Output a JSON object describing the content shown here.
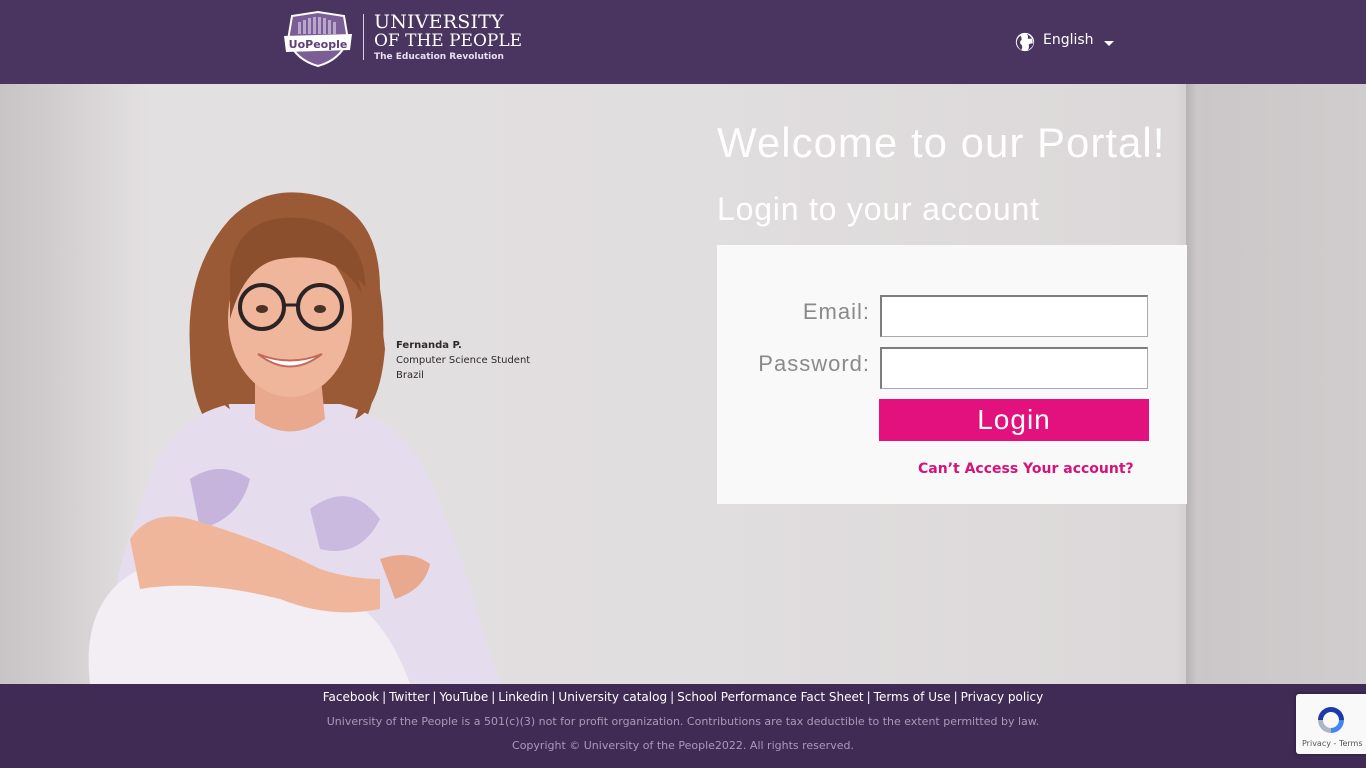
{
  "header": {
    "logo": {
      "badge_text": "UoPeople",
      "line1": "UNIVERSITY",
      "line2": "OF THE PEOPLE",
      "tagline": "The Education Revolution"
    },
    "language": {
      "selected": "English",
      "icon": "globe-icon"
    }
  },
  "hero": {
    "caption": {
      "name": "Fernanda P.",
      "role": "Computer Science Student",
      "country": "Brazil"
    },
    "welcome_title": "Welcome to our Portal!",
    "login_subtitle": "Login to your account"
  },
  "login_form": {
    "email_label": "Email:",
    "email_value": "",
    "password_label": "Password:",
    "password_value": "",
    "login_button": "Login",
    "forgot_link": "Can’t Access Your account?"
  },
  "footer": {
    "links": [
      "Facebook",
      "Twitter",
      "YouTube",
      "Linkedin",
      "University catalog",
      "School Performance Fact Sheet",
      "Terms of Use",
      "Privacy policy"
    ],
    "separator": "|",
    "nonprofit_note": "University of the People is a 501(c)(3) not for profit organization. Contributions are tax deductible to the extent permitted by law.",
    "copyright": "Copyright © University of the People2022. All rights reserved."
  },
  "recaptcha": {
    "links": "Privacy - Terms"
  },
  "colors": {
    "header_bg": "#4a3560",
    "footer_bg": "#3f2b54",
    "accent": "#e3117e",
    "link": "#d4137a"
  }
}
